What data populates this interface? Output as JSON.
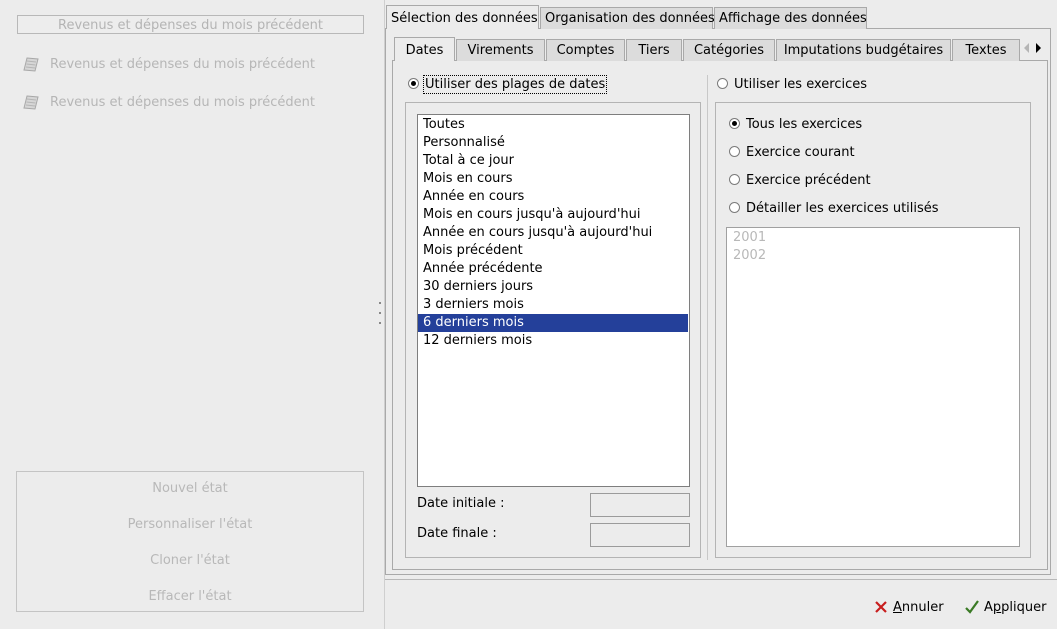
{
  "left": {
    "title": "Revenus et dépenses du mois précédent",
    "reports": [
      {
        "label": "Revenus et dépenses du mois précédent",
        "icon": "document-icon"
      },
      {
        "label": "Revenus et dépenses du mois précédent",
        "icon": "document-icon"
      }
    ],
    "buttons": {
      "new": "Nouvel état",
      "customize": "Personnaliser l'état",
      "clone": "Cloner l'état",
      "delete": "Effacer l'état"
    }
  },
  "main_tabs": [
    "Sélection des données",
    "Organisation des données",
    "Affichage des données"
  ],
  "sub_tabs": [
    "Dates",
    "Virements",
    "Comptes",
    "Tiers",
    "Catégories",
    "Imputations budgétaires",
    "Textes"
  ],
  "dates": {
    "use_ranges_label": "Utiliser des plages de dates",
    "use_ranges_selected": true,
    "ranges": [
      "Toutes",
      "Personnalisé",
      "Total à ce jour",
      "Mois en cours",
      "Année en cours",
      "Mois en cours jusqu'à aujourd'hui",
      "Année en cours jusqu'à aujourd'hui",
      "Mois précédent",
      "Année précédente",
      "30 derniers jours",
      "3 derniers mois",
      "6 derniers mois",
      "12 derniers mois"
    ],
    "selected_range": "6 derniers mois",
    "start_label": "Date initiale :",
    "end_label": "Date finale :",
    "start_value": "",
    "end_value": ""
  },
  "exercises": {
    "use_label": "Utiliser les exercices",
    "options": [
      "Tous les exercices",
      "Exercice courant",
      "Exercice précédent",
      "Détailler les exercices utilisés"
    ],
    "selected_option": "Tous les exercices",
    "years": [
      "2001",
      "2002"
    ]
  },
  "actions": {
    "cancel": "Annuler",
    "apply": "Appliquer"
  }
}
